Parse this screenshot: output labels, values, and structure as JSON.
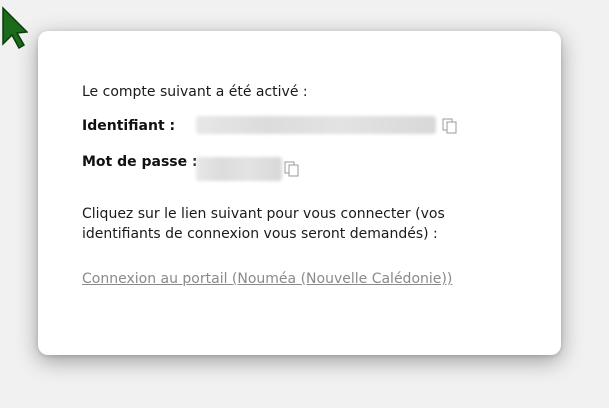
{
  "dialog": {
    "message": "Le compte suivant a été activé :",
    "username_label": "Identifiant :",
    "password_label": "Mot de passe :",
    "instructions": "Cliquez sur le lien suivant pour vous connecter (vos identifiants de connexion vous seront demandés) :",
    "portal_link": "Connexion au portail (Nouméa (Nouvelle Calédonie))"
  },
  "icons": {
    "cursor": "mouse-pointer-icon",
    "copy": "copy-icon"
  },
  "colors": {
    "cursor_fill": "#1b6b1b",
    "link": "#8a8a8a",
    "background": "#f1f1f1"
  }
}
